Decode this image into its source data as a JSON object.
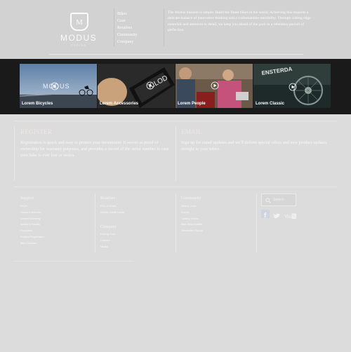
{
  "brand": {
    "name": "MODUS",
    "subtitle": "CYCLES"
  },
  "nav": {
    "items": [
      "Bikes",
      "Gear",
      "Retailers",
      "Community",
      "Company"
    ]
  },
  "intro": {
    "lead": "The Modus mission",
    "text": " is simple: Build the finest bikes in the world. Achieving this requires a delicate balance of innovative thinking and a craftsmanlike sensibility. Through cutting edge materials and attention to detail, we keep you ahead of the pack in a relentless pursuit of perfection."
  },
  "tiles": [
    {
      "caption": "Lorem Bicycles"
    },
    {
      "caption": "Lorem Accessories"
    },
    {
      "caption": "Lorem People"
    },
    {
      "caption": "Lorem Classic"
    }
  ],
  "register": {
    "title": "REGISTER",
    "text": "Registration is quick and easy to protect your investment. It serves as proof of ownership for warranty purposes, and provides a record of the serial number in case your bike is ever lost or stolen."
  },
  "email": {
    "title": "EMAIL",
    "text": "Sign up for email updates and we'll deliver special offers and new product updates straight to your inbox."
  },
  "footer": {
    "support": {
      "title": "Support",
      "links": [
        "FAQ's",
        "Owner's Manuals",
        "Limited Warranty",
        "Safety & Recalls",
        "Feedback",
        "Product Registration",
        "Bike Archives"
      ]
    },
    "retailers": {
      "title": "Retailers",
      "links": [
        "Find a Dealer",
        "Modus Credit Cards"
      ]
    },
    "company": {
      "title": "Company",
      "links": [
        "Factory Tour",
        "Careers",
        "Media"
      ]
    },
    "community": {
      "title": "Community",
      "links": [
        "Modus Crew",
        "Events",
        "Cycling Teams",
        "Bike Shop Events",
        "Newsletter Signup"
      ]
    },
    "search": {
      "placeholder": "Search"
    },
    "social": [
      "facebook-icon",
      "twitter-icon",
      "youtube-icon"
    ]
  },
  "colors": {
    "page_bg": "#dcdcdc",
    "header_bg": "#d2d2d2",
    "band_bg": "#1a1a1a",
    "text_light": "#f7f7f7"
  }
}
